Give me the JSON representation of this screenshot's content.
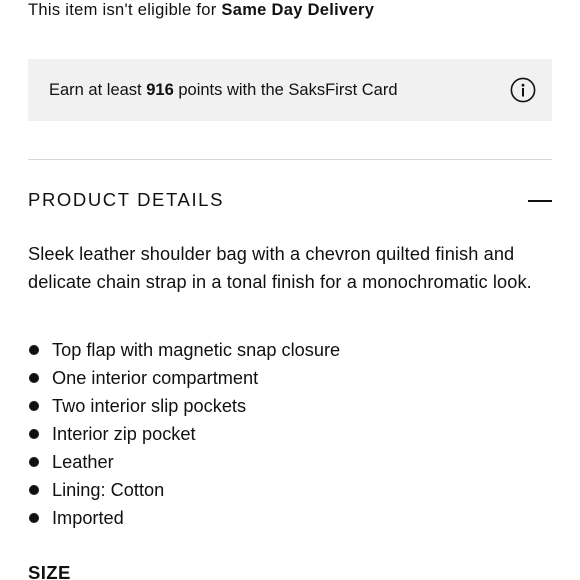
{
  "delivery": {
    "prefix": "This item isn't eligible for ",
    "emphasis": "Same Day Delivery"
  },
  "rewards": {
    "prefix": "Earn at least ",
    "points": "916",
    "suffix": " points with the SaksFirst Card",
    "icon": "info-circle-icon"
  },
  "product_details": {
    "title": "PRODUCT DETAILS",
    "toggle_icon": "minus-icon",
    "description": "Sleek leather shoulder bag with a chevron quilted finish and delicate chain strap in a tonal finish for a monochromatic look.",
    "features": [
      "Top flap with magnetic snap closure",
      "One interior compartment",
      "Two interior slip pockets",
      "Interior zip pocket",
      "Leather",
      "Lining: Cotton",
      "Imported"
    ]
  },
  "size": {
    "title": "SIZE"
  }
}
